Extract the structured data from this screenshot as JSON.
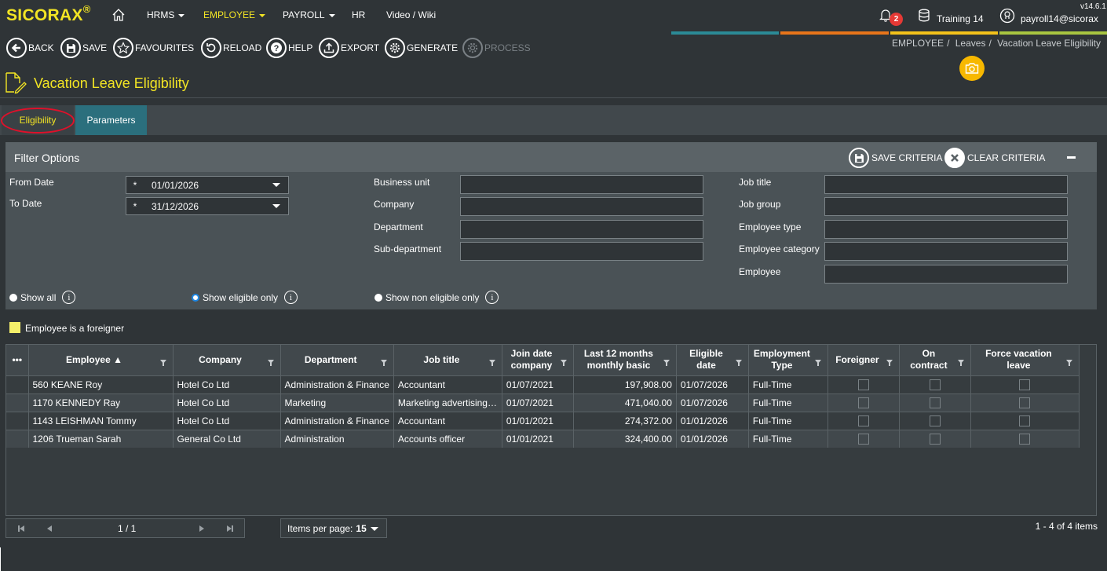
{
  "app": {
    "logo": "SICORAX",
    "logo_mark": "®",
    "version": "v14.6.1"
  },
  "nav": {
    "items": [
      {
        "label": "HRMS",
        "has_caret": true
      },
      {
        "label": "EMPLOYEE",
        "has_caret": true,
        "active": true
      },
      {
        "label": "PAYROLL",
        "has_caret": true
      },
      {
        "label": "HR",
        "has_caret": false
      },
      {
        "label": "Video / Wiki",
        "has_caret": false
      }
    ],
    "notifications": "2",
    "database": "Training 14",
    "user": "payroll14@sicorax"
  },
  "colors": {
    "accent": "#f3e524",
    "teal": "#2b8a96",
    "orange": "#e8751a",
    "yellow": "#f3c21a",
    "green": "#a8c540"
  },
  "toolbar": {
    "back": "BACK",
    "save": "SAVE",
    "favourites": "FAVOURITES",
    "reload": "RELOAD",
    "help": "HELP",
    "export": "EXPORT",
    "generate": "GENERATE",
    "process": "PROCESS"
  },
  "breadcrumb": {
    "level1": "EMPLOYEE",
    "level2": "Leaves",
    "level3": "Vacation Leave Eligibility",
    "sep": "/"
  },
  "page": {
    "title": "Vacation Leave Eligibility"
  },
  "tabs": [
    {
      "label": "Eligibility"
    },
    {
      "label": "Parameters"
    }
  ],
  "filter": {
    "title": "Filter Options",
    "save_criteria": "SAVE CRITERIA",
    "clear_criteria": "CLEAR CRITERIA",
    "from_date_label": "From Date",
    "to_date_label": "To Date",
    "from_date": "01/01/2026",
    "to_date": "31/12/2026",
    "required_mark": "*",
    "business_unit": "Business unit",
    "company": "Company",
    "department": "Department",
    "sub_department": "Sub-department",
    "job_title": "Job title",
    "job_group": "Job group",
    "employee_type": "Employee type",
    "employee_category": "Employee category",
    "employee": "Employee",
    "show_all": "Show all",
    "show_eligible": "Show eligible only",
    "show_non_eligible": "Show non eligible only",
    "info_glyph": "i"
  },
  "legend": {
    "foreigner": "Employee is a foreigner"
  },
  "grid": {
    "menu": "•••",
    "columns": [
      {
        "label": "Employee ▲"
      },
      {
        "label": "Company"
      },
      {
        "label": "Department"
      },
      {
        "label": "Job title"
      },
      {
        "label": "Join date company"
      },
      {
        "label": "Last 12 months monthly basic"
      },
      {
        "label": "Eligible date"
      },
      {
        "label": "Employment Type"
      },
      {
        "label": "Foreigner"
      },
      {
        "label": "On contract"
      },
      {
        "label": "Force vacation leave"
      }
    ],
    "rows": [
      {
        "employee": "560 KEANE Roy",
        "company": "Hotel Co Ltd",
        "department": "Administration & Finance",
        "job_title": "Accountant",
        "join_date": "01/07/2021",
        "basic": "197,908.00",
        "eligible_date": "01/07/2026",
        "type": "Full-Time"
      },
      {
        "employee": "1170 KENNEDY Ray",
        "company": "Hotel Co Ltd",
        "department": "Marketing",
        "job_title": "Marketing advertising s...",
        "join_date": "01/07/2021",
        "basic": "471,040.00",
        "eligible_date": "01/07/2026",
        "type": "Full-Time"
      },
      {
        "employee": "1143 LEISHMAN Tommy",
        "company": "Hotel Co Ltd",
        "department": "Administration & Finance",
        "job_title": "Accountant",
        "join_date": "01/01/2021",
        "basic": "274,372.00",
        "eligible_date": "01/01/2026",
        "type": "Full-Time"
      },
      {
        "employee": "1206 Trueman Sarah",
        "company": "General Co Ltd",
        "department": "Administration",
        "job_title": "Accounts officer",
        "join_date": "01/01/2021",
        "basic": "324,400.00",
        "eligible_date": "01/01/2026",
        "type": "Full-Time"
      }
    ]
  },
  "pager": {
    "page": "1 / 1",
    "items_per_page_label": "Items per page:",
    "items_per_page": "15",
    "count": "1 - 4 of 4 items"
  }
}
